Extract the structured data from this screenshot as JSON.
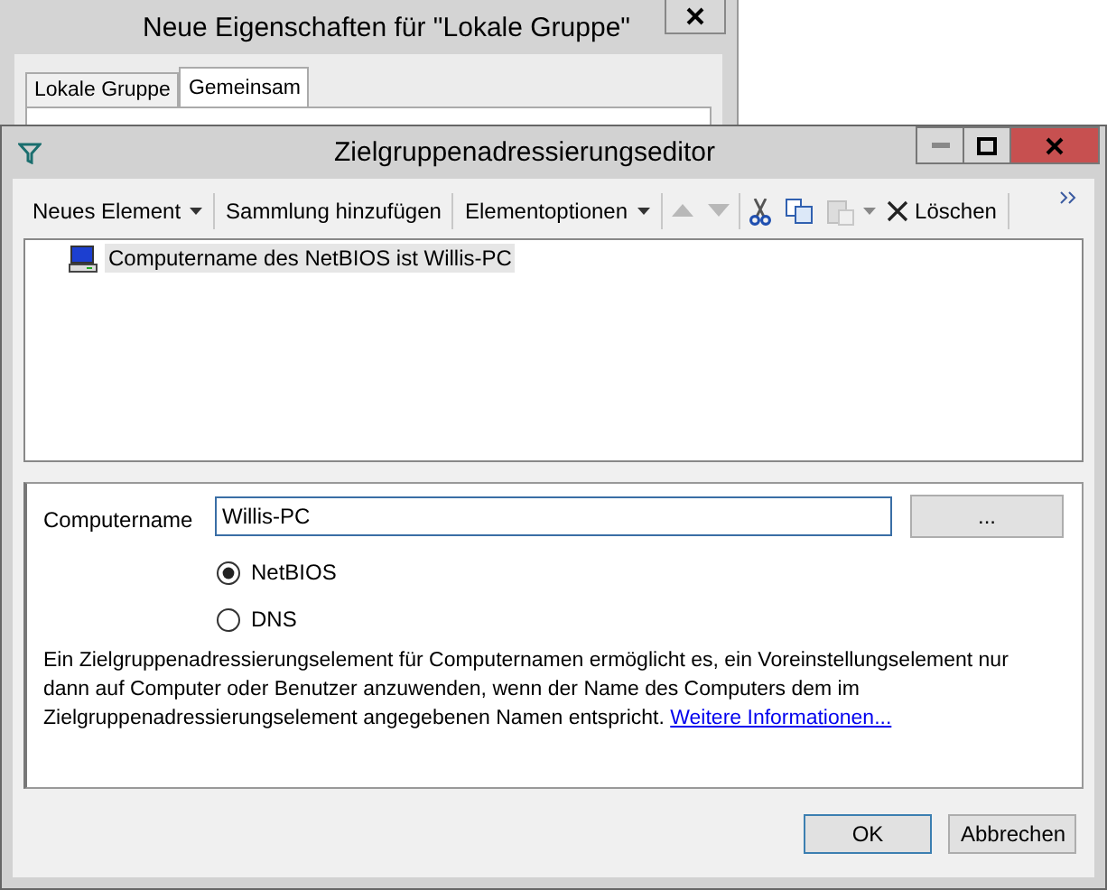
{
  "background_window": {
    "title": "Neue Eigenschaften für \"Lokale Gruppe\"",
    "tabs": [
      {
        "label": "Lokale Gruppe",
        "selected": false
      },
      {
        "label": "Gemeinsam",
        "selected": true
      }
    ]
  },
  "window": {
    "title": "Zielgruppenadressierungseditor"
  },
  "toolbar": [
    {
      "kind": "menu",
      "label": "Neues Element",
      "disabled": false
    },
    {
      "kind": "button",
      "label": "Sammlung hinzufügen",
      "disabled": false
    },
    {
      "kind": "menu",
      "label": "Elementoptionen",
      "disabled": false
    },
    {
      "kind": "up",
      "disabled": true
    },
    {
      "kind": "down",
      "disabled": true
    },
    {
      "kind": "cut",
      "disabled": false
    },
    {
      "kind": "copy",
      "disabled": false
    },
    {
      "kind": "paste",
      "disabled": true
    },
    {
      "kind": "delete",
      "label": "Löschen",
      "disabled": false
    },
    {
      "kind": "overflow",
      "disabled": false
    }
  ],
  "tree": [
    {
      "label": "Computername des NetBIOS ist Willis-PC",
      "selected": true
    }
  ],
  "form": {
    "label": "Computername",
    "value": "Willis-PC",
    "browse_button": "...",
    "radios": [
      {
        "label": "NetBIOS",
        "selected": true
      },
      {
        "label": "DNS",
        "selected": false
      }
    ],
    "description": "Ein Zielgruppenadressierungselement für Computernamen ermöglicht es, ein Voreinstellungselement nur dann auf Computer oder Benutzer anzuwenden, wenn der Name des Computers dem im Zielgruppenadressierungselement angegebenen Namen entspricht.",
    "link": "Weitere Informationen..."
  },
  "buttons": [
    {
      "label": "OK",
      "default": true
    },
    {
      "label": "Abbrechen",
      "default": false
    }
  ]
}
